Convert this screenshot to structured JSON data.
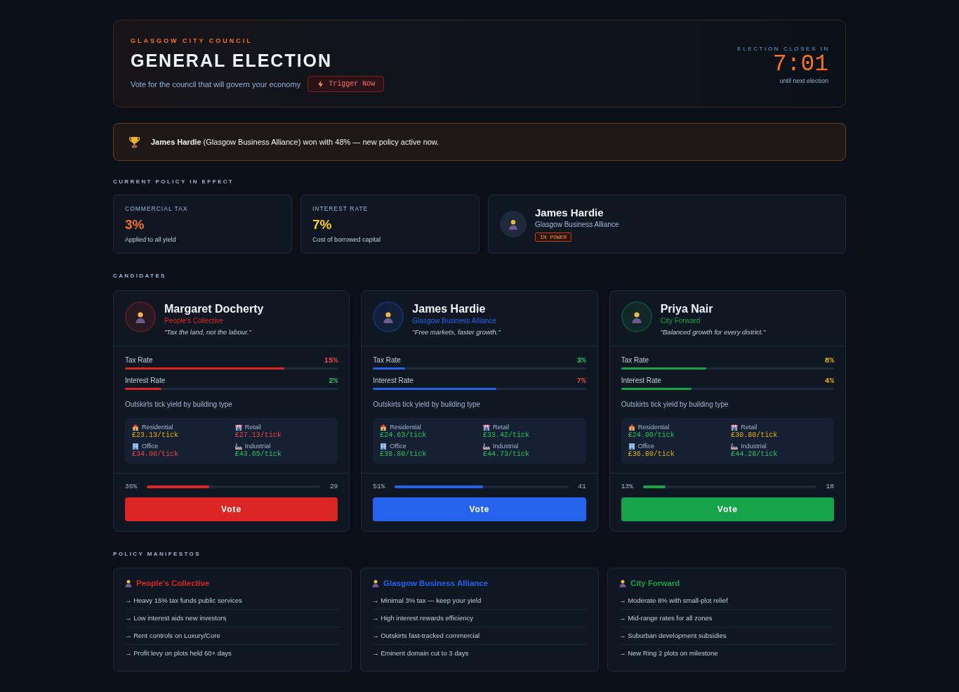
{
  "header": {
    "council": "GLASGOW CITY COUNCIL",
    "title": "GENERAL ELECTION",
    "subtitle": "Vote for the council that will govern your economy",
    "trigger_button": "Trigger Now",
    "countdown": {
      "label": "ELECTION CLOSES IN",
      "time": "7:01",
      "caption": "until next election"
    }
  },
  "result_banner": {
    "text": "**James Hardie** (Glasgow Business Alliance) won with 48% — new policy active now."
  },
  "current_policy": {
    "heading": "CURRENT POLICY IN EFFECT",
    "rates": [
      {
        "label": "COMMERCIAL TAX",
        "value": "3%",
        "note": "Applied to all yield",
        "color": "#f97316"
      },
      {
        "label": "INTEREST RATE",
        "value": "7%",
        "note": "Cost of borrowed capital",
        "color": "#facc15"
      }
    ],
    "leader": {
      "name": "James Hardie",
      "party": "Glasgow Business Alliance",
      "badge": "IN POWER"
    }
  },
  "candidates_heading": "CANDIDATES",
  "candidates": [
    {
      "name": "Margaret Docherty",
      "party": "People's Collective",
      "quote": "\"Tax the land, not the labour.\"",
      "color": "#dc2626",
      "rates": [
        {
          "label": "Tax Rate",
          "value": "15%",
          "level": 0.75,
          "color": "#ef4444"
        },
        {
          "label": "Interest Rate",
          "value": "2%",
          "level": 0.17,
          "color": "#22c55e"
        }
      ],
      "yield_heading": "Outskirts tick yield by building type",
      "yields": [
        {
          "label": "Residential",
          "value": "£23.13/tick",
          "color": "#eab308"
        },
        {
          "label": "Retail",
          "value": "£27.13/tick",
          "color": "#ef4444"
        },
        {
          "label": "Office",
          "value": "£34.00/tick",
          "color": "#ef4444"
        },
        {
          "label": "Industrial",
          "value": "£43.65/tick",
          "color": "#22c55e"
        }
      ],
      "vote_share": {
        "percent": "36%",
        "level": 0.36,
        "votes": "29"
      },
      "vote_button": "Vote"
    },
    {
      "name": "James Hardie",
      "party": "Glasgow Business Alliance",
      "quote": "\"Free markets, faster growth.\"",
      "color": "#2563eb",
      "rates": [
        {
          "label": "Tax Rate",
          "value": "3%",
          "level": 0.15,
          "color": "#22c55e"
        },
        {
          "label": "Interest Rate",
          "value": "7%",
          "level": 0.58,
          "color": "#ef4444"
        }
      ],
      "yield_heading": "Outskirts tick yield by building type",
      "yields": [
        {
          "label": "Residential",
          "value": "£24.63/tick",
          "color": "#22c55e"
        },
        {
          "label": "Retail",
          "value": "£33.42/tick",
          "color": "#22c55e"
        },
        {
          "label": "Office",
          "value": "£38.80/tick",
          "color": "#22c55e"
        },
        {
          "label": "Industrial",
          "value": "£44.73/tick",
          "color": "#22c55e"
        }
      ],
      "vote_share": {
        "percent": "51%",
        "level": 0.51,
        "votes": "41"
      },
      "vote_button": "Vote"
    },
    {
      "name": "Priya Nair",
      "party": "City Forward",
      "quote": "\"Balanced growth for every district.\"",
      "color": "#16a34a",
      "rates": [
        {
          "label": "Tax Rate",
          "value": "8%",
          "level": 0.4,
          "color": "#eab308"
        },
        {
          "label": "Interest Rate",
          "value": "4%",
          "level": 0.33,
          "color": "#eab308"
        }
      ],
      "yield_heading": "Outskirts tick yield by building type",
      "yields": [
        {
          "label": "Residential",
          "value": "£24.00/tick",
          "color": "#22c55e"
        },
        {
          "label": "Retail",
          "value": "£30.80/tick",
          "color": "#eab308"
        },
        {
          "label": "Office",
          "value": "£36.80/tick",
          "color": "#eab308"
        },
        {
          "label": "Industrial",
          "value": "£44.28/tick",
          "color": "#22c55e"
        }
      ],
      "vote_share": {
        "percent": "13%",
        "level": 0.13,
        "votes": "10"
      },
      "vote_button": "Vote"
    }
  ],
  "manifestos_heading": "POLICY MANIFESTOS",
  "manifestos": [
    {
      "party": "People's Collective",
      "color": "#dc2626",
      "points": [
        "→ Heavy 15% tax funds public services",
        "→ Low interest aids new investors",
        "→ Rent controls on Luxury/Core",
        "→ Profit levy on plots held 60+ days"
      ]
    },
    {
      "party": "Glasgow Business Alliance",
      "color": "#2563eb",
      "points": [
        "→ Minimal 3% tax — keep your yield",
        "→ High interest rewards efficiency",
        "→ Outskirts fast-tracked commercial",
        "→ Eminent domain cut to 3 days"
      ]
    },
    {
      "party": "City Forward",
      "color": "#16a34a",
      "points": [
        "→ Moderate 8% with small-plot relief",
        "→ Mid-range rates for all zones",
        "→ Suburban development subsidies",
        "→ New Ring 2 plots on milestone"
      ]
    }
  ]
}
